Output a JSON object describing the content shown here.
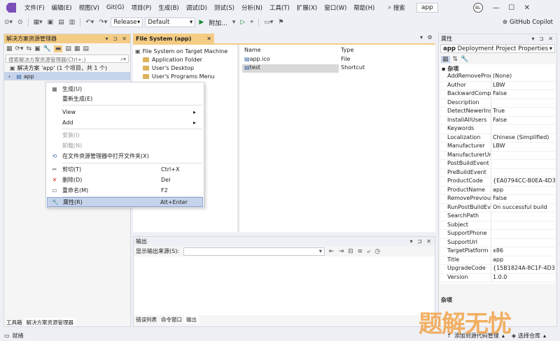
{
  "menubar": {
    "items": [
      "文件(F)",
      "编辑(E)",
      "视图(V)",
      "Git(G)",
      "项目(P)",
      "生成(B)",
      "调试(D)",
      "测试(S)",
      "分析(N)",
      "工具(T)",
      "扩展(X)",
      "窗口(W)",
      "帮助(H)"
    ],
    "search": "搜索",
    "app_title": "app",
    "avatar": "BL"
  },
  "toolbar": {
    "config": "Release",
    "platform": "Default",
    "attach": "附加...",
    "copilot": "GitHub Copilot"
  },
  "solution_explorer": {
    "title": "解决方案资源管理器",
    "search_placeholder": "搜索解决方案资源管理器(Ctrl+;)",
    "root": "解决方案 'app' (1 个项目，共 1 个)",
    "project": "app",
    "tabs": [
      "工具箱",
      "解决方案资源管理器"
    ]
  },
  "filesystem": {
    "tab": "File System (app)",
    "tree_root": "File System on Target Machine",
    "folders": [
      "Application Folder",
      "User's Desktop",
      "User's Programs Menu"
    ],
    "col_name": "Name",
    "col_type": "Type",
    "rows": [
      {
        "name": "app.ico",
        "type": "File"
      },
      {
        "name": "test",
        "type": "Shortcut"
      }
    ]
  },
  "output": {
    "title": "输出",
    "source_label": "显示输出来源(S):",
    "tabs": [
      "错误列表",
      "命令窗口",
      "输出"
    ]
  },
  "properties": {
    "title": "属性",
    "object": "app",
    "object_type": "Deployment Project Properties",
    "category": "杂项",
    "rows": [
      [
        "AddRemoveProg",
        "(None)"
      ],
      [
        "Author",
        "LBW"
      ],
      [
        "BackwardCompat",
        "False"
      ],
      [
        "Description",
        ""
      ],
      [
        "DetectNewerInst",
        "True"
      ],
      [
        "InstallAllUsers",
        "False"
      ],
      [
        "Keywords",
        ""
      ],
      [
        "Localization",
        "Chinese (Simplified)"
      ],
      [
        "Manufacturer",
        "LBW"
      ],
      [
        "ManufacturerUrl",
        ""
      ],
      [
        "PostBuildEvent",
        ""
      ],
      [
        "PreBuildEvent",
        ""
      ],
      [
        "ProductCode",
        "{EA0794CC-B0EA-4D3"
      ],
      [
        "ProductName",
        "app"
      ],
      [
        "RemovePrevious",
        "False"
      ],
      [
        "RunPostBuildEver",
        "On successful build"
      ],
      [
        "SearchPath",
        ""
      ],
      [
        "Subject",
        ""
      ],
      [
        "SupportPhone",
        ""
      ],
      [
        "SupportUrl",
        ""
      ],
      [
        "TargetPlatform",
        "x86"
      ],
      [
        "Title",
        "app"
      ],
      [
        "UpgradeCode",
        "{15B1824A-8C1F-4D32"
      ],
      [
        "Version",
        "1.0.0"
      ]
    ],
    "desc_title": "杂项"
  },
  "context_menu": {
    "items": [
      {
        "label": "生成(U)",
        "shortcut": "",
        "icon": "build-icon",
        "disabled": false
      },
      {
        "label": "重新生成(E)",
        "shortcut": "",
        "icon": "",
        "disabled": false
      },
      {
        "label": "View",
        "shortcut": "▸",
        "icon": "",
        "disabled": false
      },
      {
        "label": "Add",
        "shortcut": "▸",
        "icon": "",
        "disabled": false
      },
      {
        "label": "安装(I)",
        "shortcut": "",
        "icon": "",
        "disabled": true
      },
      {
        "label": "卸载(N)",
        "shortcut": "",
        "icon": "",
        "disabled": true
      },
      {
        "label": "在文件资源管理器中打开文件夹(X)",
        "shortcut": "",
        "icon": "refresh-icon",
        "disabled": false
      },
      {
        "label": "剪切(T)",
        "shortcut": "Ctrl+X",
        "icon": "scissors-icon",
        "disabled": false
      },
      {
        "label": "删除(D)",
        "shortcut": "Del",
        "icon": "delete-icon",
        "disabled": false
      },
      {
        "label": "重命名(M)",
        "shortcut": "F2",
        "icon": "rename-icon",
        "disabled": false
      },
      {
        "label": "属性(R)",
        "shortcut": "Alt+Enter",
        "icon": "wrench-icon",
        "disabled": false
      }
    ]
  },
  "status": {
    "ready": "就绪",
    "source_control": "添加到源代码管理",
    "select_repo": "选择仓库"
  },
  "watermark": "题解无忧"
}
